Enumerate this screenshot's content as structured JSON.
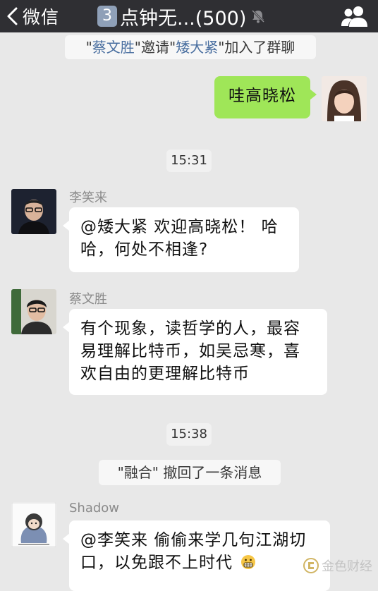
{
  "navbar": {
    "back_label": "微信",
    "badge_number": "3",
    "title": "点钟无...(500)"
  },
  "chat": {
    "system_join": {
      "quote_open_1": "\"",
      "inviter": "蔡文胜",
      "quote_mid_1": "\"邀请\"",
      "invitee": "矮大紧",
      "quote_end_1": "\"加入了群聊"
    },
    "my_message": "哇高晓松",
    "time_1": "15:31",
    "msg_1": {
      "sender": "李笑来",
      "text": "@矮大紧 欢迎高晓松！ 哈哈，何处不相逢?"
    },
    "msg_2": {
      "sender": "蔡文胜",
      "text": "有个现象，读哲学的人，最容易理解比特币，如吴忌寒，喜欢自由的更理解比特币"
    },
    "time_2": "15:38",
    "recall_notice": "\"融合\" 撤回了一条消息",
    "msg_3": {
      "sender": "Shadow",
      "text": "@李笑来 偷偷来学几句江湖切口，以免跟不上时代"
    }
  },
  "watermark": "金色财经",
  "colors": {
    "navbar_bg": "#2f2f33",
    "chat_bg": "#e8e8e8",
    "my_bubble": "#9fe658",
    "other_bubble": "#ffffff",
    "name_link": "#4a6fa0"
  }
}
